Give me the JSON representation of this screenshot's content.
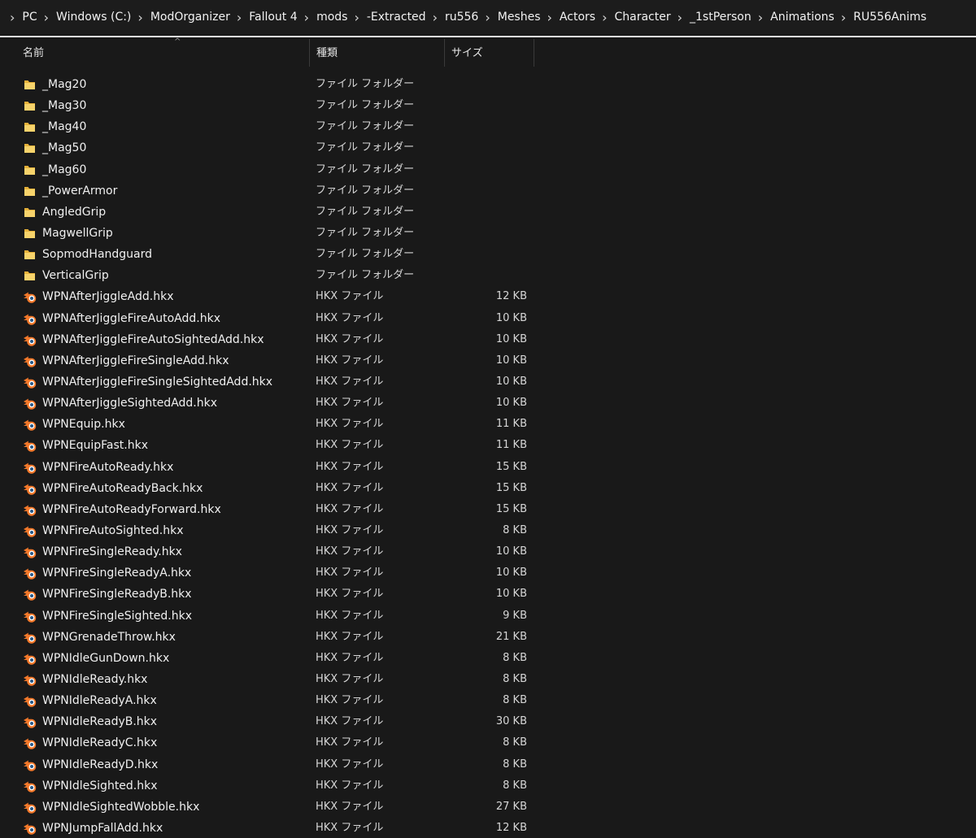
{
  "colors": {
    "background": "#191919",
    "text": "#f0f0f0",
    "folder_icon": "#f2c94c",
    "blender_orange": "#f5792a",
    "blender_blue": "#265787"
  },
  "address_bar": {
    "separator_icon": "chevron-right-icon",
    "crumbs": [
      "PC",
      "Windows (C:)",
      "ModOrganizer",
      "Fallout 4",
      "mods",
      "-Extracted",
      "ru556",
      "Meshes",
      "Actors",
      "Character",
      "_1stPerson",
      "Animations",
      "RU556Anims"
    ]
  },
  "columns": {
    "name": "名前",
    "type": "種類",
    "size": "サイズ"
  },
  "files": [
    {
      "name": "_Mag20",
      "type": "ファイル フォルダー",
      "size": "",
      "icon": "folder-icon"
    },
    {
      "name": "_Mag30",
      "type": "ファイル フォルダー",
      "size": "",
      "icon": "folder-icon"
    },
    {
      "name": "_Mag40",
      "type": "ファイル フォルダー",
      "size": "",
      "icon": "folder-icon"
    },
    {
      "name": "_Mag50",
      "type": "ファイル フォルダー",
      "size": "",
      "icon": "folder-icon"
    },
    {
      "name": "_Mag60",
      "type": "ファイル フォルダー",
      "size": "",
      "icon": "folder-icon"
    },
    {
      "name": "_PowerArmor",
      "type": "ファイル フォルダー",
      "size": "",
      "icon": "folder-icon"
    },
    {
      "name": "AngledGrip",
      "type": "ファイル フォルダー",
      "size": "",
      "icon": "folder-icon"
    },
    {
      "name": "MagwellGrip",
      "type": "ファイル フォルダー",
      "size": "",
      "icon": "folder-icon"
    },
    {
      "name": "SopmodHandguard",
      "type": "ファイル フォルダー",
      "size": "",
      "icon": "folder-icon"
    },
    {
      "name": "VerticalGrip",
      "type": "ファイル フォルダー",
      "size": "",
      "icon": "folder-icon"
    },
    {
      "name": "WPNAfterJiggleAdd.hkx",
      "type": "HKX ファイル",
      "size": "12 KB",
      "icon": "blender-file-icon"
    },
    {
      "name": "WPNAfterJiggleFireAutoAdd.hkx",
      "type": "HKX ファイル",
      "size": "10 KB",
      "icon": "blender-file-icon"
    },
    {
      "name": "WPNAfterJiggleFireAutoSightedAdd.hkx",
      "type": "HKX ファイル",
      "size": "10 KB",
      "icon": "blender-file-icon"
    },
    {
      "name": "WPNAfterJiggleFireSingleAdd.hkx",
      "type": "HKX ファイル",
      "size": "10 KB",
      "icon": "blender-file-icon"
    },
    {
      "name": "WPNAfterJiggleFireSingleSightedAdd.hkx",
      "type": "HKX ファイル",
      "size": "10 KB",
      "icon": "blender-file-icon"
    },
    {
      "name": "WPNAfterJiggleSightedAdd.hkx",
      "type": "HKX ファイル",
      "size": "10 KB",
      "icon": "blender-file-icon"
    },
    {
      "name": "WPNEquip.hkx",
      "type": "HKX ファイル",
      "size": "11 KB",
      "icon": "blender-file-icon"
    },
    {
      "name": "WPNEquipFast.hkx",
      "type": "HKX ファイル",
      "size": "11 KB",
      "icon": "blender-file-icon"
    },
    {
      "name": "WPNFireAutoReady.hkx",
      "type": "HKX ファイル",
      "size": "15 KB",
      "icon": "blender-file-icon"
    },
    {
      "name": "WPNFireAutoReadyBack.hkx",
      "type": "HKX ファイル",
      "size": "15 KB",
      "icon": "blender-file-icon"
    },
    {
      "name": "WPNFireAutoReadyForward.hkx",
      "type": "HKX ファイル",
      "size": "15 KB",
      "icon": "blender-file-icon"
    },
    {
      "name": "WPNFireAutoSighted.hkx",
      "type": "HKX ファイル",
      "size": "8 KB",
      "icon": "blender-file-icon"
    },
    {
      "name": "WPNFireSingleReady.hkx",
      "type": "HKX ファイル",
      "size": "10 KB",
      "icon": "blender-file-icon"
    },
    {
      "name": "WPNFireSingleReadyA.hkx",
      "type": "HKX ファイル",
      "size": "10 KB",
      "icon": "blender-file-icon"
    },
    {
      "name": "WPNFireSingleReadyB.hkx",
      "type": "HKX ファイル",
      "size": "10 KB",
      "icon": "blender-file-icon"
    },
    {
      "name": "WPNFireSingleSighted.hkx",
      "type": "HKX ファイル",
      "size": "9 KB",
      "icon": "blender-file-icon"
    },
    {
      "name": "WPNGrenadeThrow.hkx",
      "type": "HKX ファイル",
      "size": "21 KB",
      "icon": "blender-file-icon"
    },
    {
      "name": "WPNIdleGunDown.hkx",
      "type": "HKX ファイル",
      "size": "8 KB",
      "icon": "blender-file-icon"
    },
    {
      "name": "WPNIdleReady.hkx",
      "type": "HKX ファイル",
      "size": "8 KB",
      "icon": "blender-file-icon"
    },
    {
      "name": "WPNIdleReadyA.hkx",
      "type": "HKX ファイル",
      "size": "8 KB",
      "icon": "blender-file-icon"
    },
    {
      "name": "WPNIdleReadyB.hkx",
      "type": "HKX ファイル",
      "size": "30 KB",
      "icon": "blender-file-icon"
    },
    {
      "name": "WPNIdleReadyC.hkx",
      "type": "HKX ファイル",
      "size": "8 KB",
      "icon": "blender-file-icon"
    },
    {
      "name": "WPNIdleReadyD.hkx",
      "type": "HKX ファイル",
      "size": "8 KB",
      "icon": "blender-file-icon"
    },
    {
      "name": "WPNIdleSighted.hkx",
      "type": "HKX ファイル",
      "size": "8 KB",
      "icon": "blender-file-icon"
    },
    {
      "name": "WPNIdleSightedWobble.hkx",
      "type": "HKX ファイル",
      "size": "27 KB",
      "icon": "blender-file-icon"
    },
    {
      "name": "WPNJumpFallAdd.hkx",
      "type": "HKX ファイル",
      "size": "12 KB",
      "icon": "blender-file-icon"
    }
  ]
}
